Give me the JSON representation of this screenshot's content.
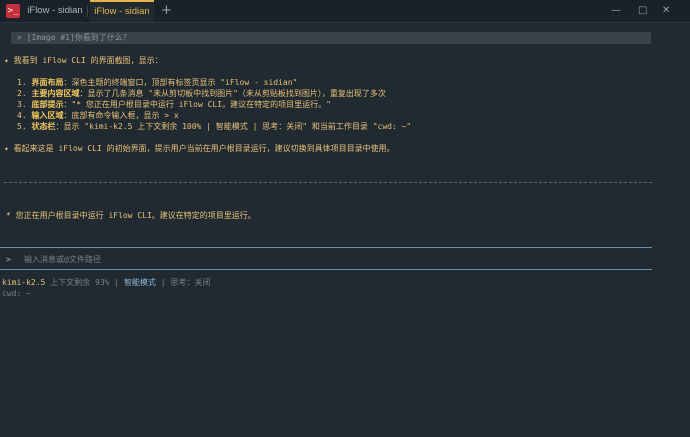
{
  "titlebar": {
    "tabs": [
      {
        "label": "iFlow - sidian"
      },
      {
        "label": "iFlow - sidian"
      }
    ],
    "new_tab": "+",
    "controls": {
      "minimize": "—",
      "maximize": "□",
      "close": "✕"
    }
  },
  "terminal": {
    "query": "> [Image #1]你看到了什么？",
    "response_intro": "我看到 iFlow CLI 的界面截图，显示：",
    "items": [
      {
        "num": "1.",
        "head": "界面布局",
        "body": "：深色主题的终端窗口，顶部有标签页显示 \"iFlow - sidian\""
      },
      {
        "num": "2.",
        "head": "主要内容区域",
        "body": "：显示了几条消息 \"未从剪切板中找到图片\"（未从剪贴板找到图片），重复出现了多次"
      },
      {
        "num": "3.",
        "head": "底部提示",
        "body": "：\"* 您正在用户根目录中运行 iFlow CLI。建议在特定的项目里运行。\""
      },
      {
        "num": "4.",
        "head": "输入区域",
        "body": "：底部有命令输入框，显示 > x"
      },
      {
        "num": "5.",
        "head": "状态栏",
        "body": "：显示 \"kimi-k2.5 上下文剩余 100% | 智能模式 | 思考：关闭\" 和当前工作目录 \"cwd: ~\""
      }
    ],
    "conclusion": "看起来这是 iFlow CLI 的初始界面，提示用户当前在用户根目录运行，建议切换到具体项目目录中使用。",
    "warning": "* 您正在用户根目录中运行 iFlow CLI。建议在特定的项目里运行。",
    "prompt_symbol": ">",
    "input_placeholder": "输入消息或@文件路径",
    "status": {
      "model": "kimi-k2.5",
      "context": "上下文剩余 93%",
      "sep1": "|",
      "mode": "智能模式",
      "sep2": "|",
      "thinking": "思考：关闭"
    },
    "cwd": "cwd: ~"
  },
  "colors": {
    "background": "#212a31",
    "accent": "#e8b54a",
    "highlight_text": "#e8c27a",
    "mode_text": "#8fb8d8"
  }
}
